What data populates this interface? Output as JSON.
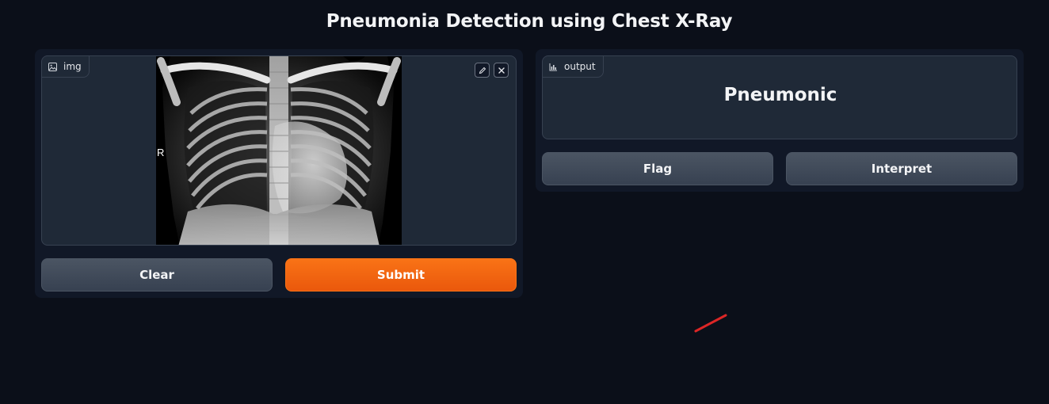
{
  "app": {
    "title": "Pneumonia Detection using Chest X-Ray"
  },
  "input": {
    "label": "img",
    "label_icon": "image-icon",
    "xray_marker": "R",
    "edit_icon": "pencil-icon",
    "remove_icon": "close-icon"
  },
  "input_actions": {
    "clear_label": "Clear",
    "submit_label": "Submit"
  },
  "output": {
    "label": "output",
    "label_icon": "bar-chart-icon",
    "prediction": "Pneumonic"
  },
  "output_actions": {
    "flag_label": "Flag",
    "interpret_label": "Interpret"
  },
  "colors": {
    "background": "#0b0f19",
    "panel": "#111827",
    "block": "#1f2937",
    "border": "#374151",
    "primary": "#f97316",
    "secondary": "#4b5563",
    "annotation": "#dc2626"
  }
}
